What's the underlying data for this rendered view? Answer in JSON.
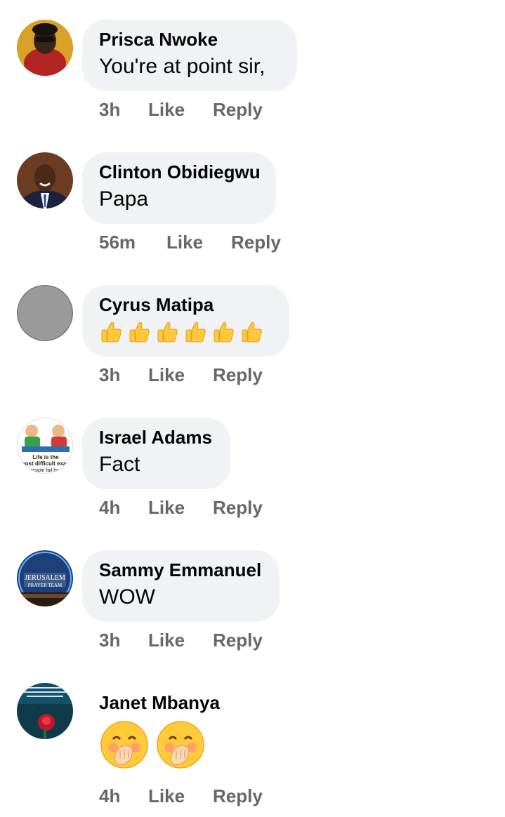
{
  "comments": [
    {
      "author": "Prisca Nwoke",
      "text": "You're at point sir,",
      "time": "3h",
      "like": "Like",
      "reply": "Reply",
      "avatar": "woman-photo"
    },
    {
      "author": "Clinton Obidiegwu",
      "text": "Papa",
      "time": "56m",
      "like": "Like",
      "reply": "Reply",
      "avatar": "man-suit-photo"
    },
    {
      "author": "Cyrus Matipa",
      "text": "👍👍👍👍👍👍",
      "time": "3h",
      "like": "Like",
      "reply": "Reply",
      "avatar": "default-gray"
    },
    {
      "author": "Israel Adams",
      "text": "Fact",
      "time": "4h",
      "like": "Like",
      "reply": "Reply",
      "avatar": "cartoon-exam",
      "avatar_text": [
        "Life is the",
        "most difficult exam",
        "people fail bec"
      ]
    },
    {
      "author": "Sammy Emmanuel",
      "text": "WOW",
      "time": "3h",
      "like": "Like",
      "reply": "Reply",
      "avatar": "jerusalem-prayer-team",
      "avatar_text": [
        "JERUSALEM",
        "PRAYER TEAM"
      ]
    },
    {
      "author": "Janet Mbanya",
      "text": "🫢🫢",
      "time": "4h",
      "like": "Like",
      "reply": "Reply",
      "avatar": "rose-quote"
    }
  ],
  "colors": {
    "bubble": "#f0f2f5",
    "meta": "#65676b",
    "text": "#050505"
  }
}
